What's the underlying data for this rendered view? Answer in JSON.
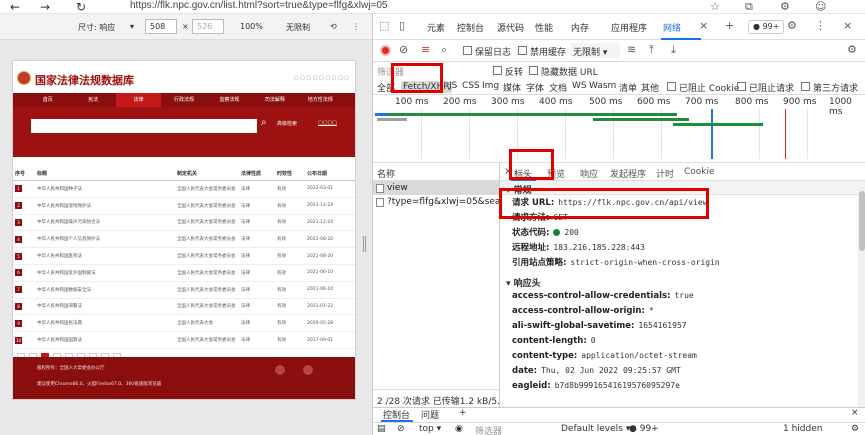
{
  "browser": {
    "url": "https://flk.npc.gov.cn/list.html?sort=true&type=flfg&xlwj=05"
  },
  "device_toolbar": {
    "dimensions_label": "尺寸: 响应",
    "width_value": "508",
    "height_value": "526",
    "zoom": "100%",
    "throttle": "无限制"
  },
  "site": {
    "title": "国家法律法规数据库",
    "menu": [
      "首页",
      "宪法",
      "法律",
      "行政法规",
      "监察法规",
      "司法解释",
      "地方性法规"
    ],
    "search_button": "高级检索",
    "table_headers": [
      "序号",
      "标题",
      "制定机关",
      "法律性质",
      "时效性",
      "公布日期"
    ],
    "rows": [
      {
        "n": "1",
        "title": "中华人民共和国种子法",
        "org": "全国人民代表大会常务委员会",
        "type": "法律",
        "status": "有效",
        "date": "2022-03-01"
      },
      {
        "n": "2",
        "title": "中华人民共和国湿地保护法",
        "org": "全国人民代表大会常务委员会",
        "type": "法律",
        "status": "有效",
        "date": "2021-12-24"
      },
      {
        "n": "3",
        "title": "中华人民共和国噪声污染防治法",
        "org": "全国人民代表大会常务委员会",
        "type": "法律",
        "status": "有效",
        "date": "2021-12-24"
      },
      {
        "n": "4",
        "title": "中华人民共和国个人信息保护法",
        "org": "全国人民代表大会常务委员会",
        "type": "法律",
        "status": "有效",
        "date": "2021-08-20"
      },
      {
        "n": "5",
        "title": "中华人民共和国医师法",
        "org": "全国人民代表大会常务委员会",
        "type": "法律",
        "status": "有效",
        "date": "2021-08-20"
      },
      {
        "n": "6",
        "title": "中华人民共和国反外国制裁法",
        "org": "全国人民代表大会常务委员会",
        "type": "法律",
        "status": "有效",
        "date": "2021-06-10"
      },
      {
        "n": "7",
        "title": "中华人民共和国数据安全法",
        "org": "全国人民代表大会常务委员会",
        "type": "法律",
        "status": "有效",
        "date": "2021-06-10"
      },
      {
        "n": "8",
        "title": "中华人民共和国海警法",
        "org": "全国人民代表大会常务委员会",
        "type": "法律",
        "status": "有效",
        "date": "2021-01-22"
      },
      {
        "n": "9",
        "title": "中华人民共和国民法典",
        "org": "全国人民代表大会",
        "type": "法律",
        "status": "有效",
        "date": "2020-05-28"
      },
      {
        "n": "10",
        "title": "中华人民共和国国歌法",
        "org": "全国人民代表大会常务委员会",
        "type": "法律",
        "status": "有效",
        "date": "2017-09-01"
      }
    ],
    "footer_lines": [
      "版权所有：全国人大常委会办公厅",
      "建议使用Chrome86.0、火狐Firefox67.0、360极速版浏览器"
    ]
  },
  "devtools": {
    "tabs": [
      "元素",
      "控制台",
      "源代码",
      "性能",
      "内存",
      "应用程序",
      "网络"
    ],
    "active_tab": "网络",
    "issues_badge": "99+",
    "toolbar": {
      "preserve_log": "保留日志",
      "disable_cache": "禁用缓存",
      "throttle": "无限制"
    },
    "filter": {
      "placeholder": "筛选器",
      "invert": "反转",
      "hide_data_urls": "隐藏数据 URL",
      "types": [
        "全部",
        "Fetch/XHR",
        "JS",
        "CSS",
        "Img",
        "媒体",
        "字体",
        "文档",
        "WS",
        "Wasm",
        "清单",
        "其他"
      ],
      "blocked_cookies": "已阻止 Cookie",
      "blocked_requests": "已阻止请求",
      "third_party": "第三方请求"
    },
    "timeline_ticks": [
      "100 ms",
      "200 ms",
      "300 ms",
      "400 ms",
      "500 ms",
      "600 ms",
      "700 ms",
      "800 ms",
      "900 ms",
      "1000 ms"
    ],
    "requests": {
      "header": "名称",
      "items": [
        "view",
        "?type=flfg&xlwj=05&searc..."
      ],
      "status": "2 /28 次请求  已传输1.2 kB/5.0 kB"
    },
    "detail": {
      "tabs": [
        "标头",
        "预览",
        "响应",
        "发起程序",
        "计时",
        "Cookie"
      ],
      "active_tab": "标头",
      "general_title": "常规",
      "general": [
        {
          "k": "请求 URL:",
          "v": "https://flk.npc.gov.cn/api/view"
        },
        {
          "k": "请求方法:",
          "v": "GET"
        },
        {
          "k": "状态代码:",
          "v": "200"
        },
        {
          "k": "远程地址:",
          "v": "183.216.185.228:443"
        },
        {
          "k": "引用站点策略:",
          "v": "strict-origin-when-cross-origin"
        }
      ],
      "response_title": "响应头",
      "response": [
        {
          "k": "access-control-allow-credentials:",
          "v": "true"
        },
        {
          "k": "access-control-allow-origin:",
          "v": "*"
        },
        {
          "k": "ali-swift-global-savetime:",
          "v": "1654161957"
        },
        {
          "k": "content-length:",
          "v": "0"
        },
        {
          "k": "content-type:",
          "v": "application/octet-stream"
        },
        {
          "k": "date:",
          "v": "Thu, 02 Jun 2022 09:25:57 GMT"
        },
        {
          "k": "eagleid:",
          "v": "b7d8b99916541619576095297e"
        }
      ]
    },
    "drawer": {
      "tabs": [
        "控制台",
        "问题"
      ],
      "context": "top",
      "filter_placeholder": "筛选器",
      "levels": "Default levels",
      "badge": "99+",
      "hidden": "1 hidden"
    }
  },
  "colors": {
    "site_red": "#8b0e0e",
    "accent_blue": "#1a73e8",
    "highlight_red": "#e00000"
  }
}
